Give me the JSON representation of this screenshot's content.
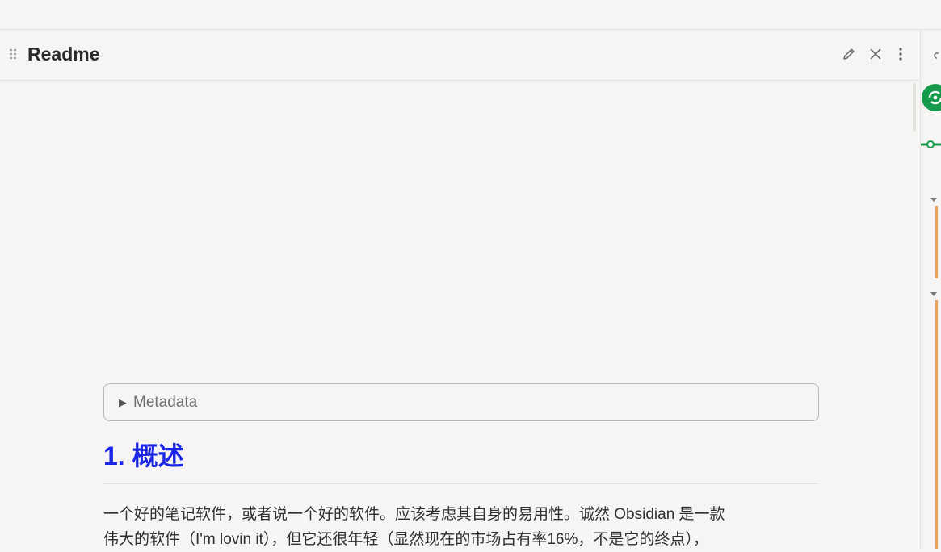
{
  "pane": {
    "title": "Readme"
  },
  "icons": {
    "drag": "drag-handle-icon",
    "edit": "pencil-icon",
    "close": "close-icon",
    "more": "more-vertical-icon"
  },
  "content": {
    "metadata_label": "Metadata",
    "heading": "1. 概述",
    "paragraph_lines": [
      "一个好的笔记软件，或者说一个好的软件。应该考虑其自身的易用性。诚然 Obsidian 是一款",
      "伟大的软件（I'm lovin it），但它还很年轻（显然现在的市场占有率16%，不是它的终点），"
    ]
  },
  "colors": {
    "heading": "#1a25e6",
    "rail_green": "#159a4b",
    "rail_orange": "#f0a25a"
  }
}
